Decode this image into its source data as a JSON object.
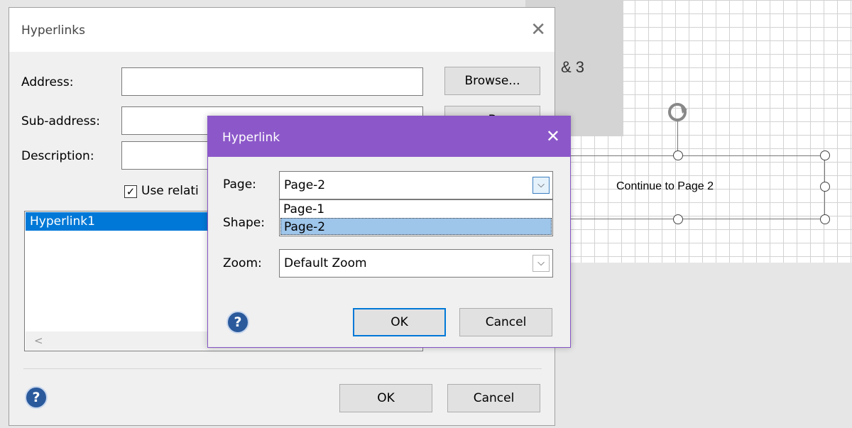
{
  "canvas": {
    "fragment_text": "& 3",
    "shape_label": "Continue to Page 2"
  },
  "hyperlinks_dialog": {
    "title": "Hyperlinks",
    "close_glyph": "✕",
    "address_label": "Address:",
    "sub_address_label": "Sub-address:",
    "description_label": "Description:",
    "address_value": "",
    "sub_address_value": "",
    "description_value": "",
    "browse_label": "Browse...",
    "browse2_label": "B",
    "use_relative_label": "Use relati",
    "use_relative_checked": true,
    "list_items": [
      "Hyperlink1"
    ],
    "scroll_left_glyph": "<",
    "help_glyph": "?",
    "ok_label": "OK",
    "cancel_label": "Cancel"
  },
  "hyperlink_dialog": {
    "title": "Hyperlink",
    "close_glyph": "✕",
    "page_label": "Page:",
    "page_value": "Page-2",
    "page_options": [
      "Page-1",
      "Page-2"
    ],
    "page_selected_index": 1,
    "shape_label": "Shape:",
    "zoom_label": "Zoom:",
    "zoom_value": "Default Zoom",
    "dropdown_glyph": "⌵",
    "help_glyph": "?",
    "ok_label": "OK",
    "cancel_label": "Cancel"
  },
  "colors": {
    "accent_purple": "#8c58c9",
    "selection_blue": "#0078d7"
  }
}
